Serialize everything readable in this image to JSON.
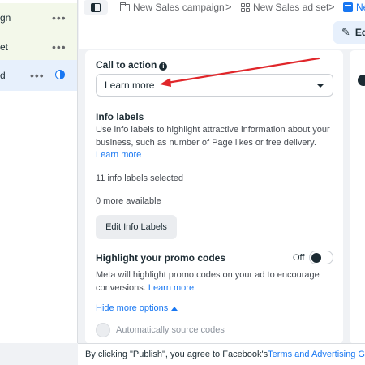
{
  "sidebar": {
    "items": [
      {
        "label": "gn",
        "more": "•••"
      },
      {
        "label": "et",
        "more": "•••"
      },
      {
        "label": "d",
        "more": "•••"
      }
    ]
  },
  "breadcrumb": {
    "campaign": "New Sales campaign",
    "ad_set": "New Sales ad set",
    "ad": "Ne",
    "separator": ">"
  },
  "edit_button": {
    "label": "Ed"
  },
  "call_to_action": {
    "label": "Call to action",
    "info": "i",
    "selected": "Learn more"
  },
  "info_labels": {
    "heading": "Info labels",
    "description": "Use info labels to highlight attractive information about your business, such as number of Page likes or free delivery.",
    "learn_more": "Learn more",
    "selected_count": "11 info labels selected",
    "available": "0 more available",
    "edit_button": "Edit Info Labels"
  },
  "promo_codes": {
    "heading": "Highlight your promo codes",
    "toggle_state": "Off",
    "description": "Meta will highlight promo codes on your ad to encourage conversions.",
    "learn_more": "Learn more",
    "hide_more": "Hide more options",
    "auto_source": "Automatically source codes"
  },
  "footer": {
    "text": "By clicking \"Publish\", you agree to Facebook's ",
    "link": "Terms and Advertising Gu"
  },
  "colors": {
    "accent": "#1877f2",
    "annotation_arrow": "#e0262a"
  }
}
